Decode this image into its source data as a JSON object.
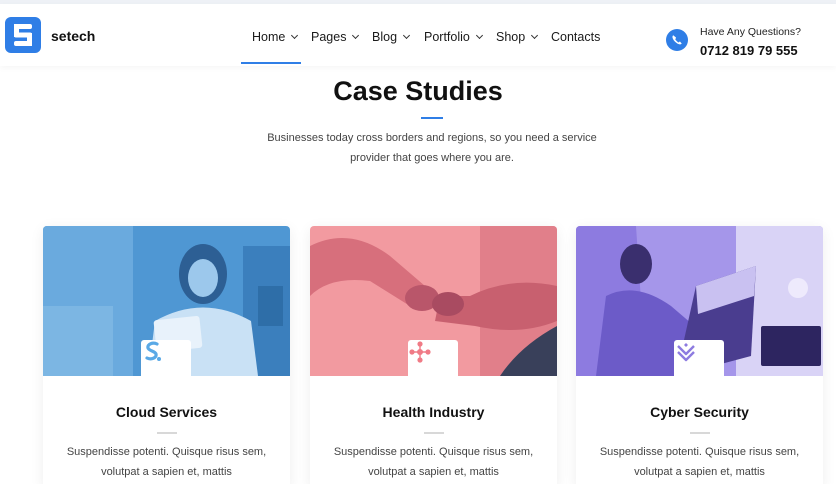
{
  "header": {
    "brand": "setech",
    "nav": [
      {
        "label": "Home",
        "dropdown": true
      },
      {
        "label": "Pages",
        "dropdown": true
      },
      {
        "label": "Blog",
        "dropdown": true
      },
      {
        "label": "Portfolio",
        "dropdown": true
      },
      {
        "label": "Shop",
        "dropdown": true
      },
      {
        "label": "Contacts",
        "dropdown": false
      }
    ],
    "active_nav": "Home",
    "contact": {
      "question": "Have Any Questions?",
      "phone": "0712 819 79 555",
      "icon": "whatsapp-phone-icon"
    }
  },
  "section": {
    "title": "Case Studies",
    "subtitle_line1": "Businesses today cross borders and regions, so you need a service",
    "subtitle_line2": "provider that goes where you are."
  },
  "cards": [
    {
      "title": "Cloud Services",
      "text_line1": "Suspendisse potenti. Quisque risus sem,",
      "text_line2": "volutpat a sapien et, mattis",
      "icon": "cloud-s-icon",
      "tint": "#5aa9e6"
    },
    {
      "title": "Health Industry",
      "text_line1": "Suspendisse potenti. Quisque risus sem,",
      "text_line2": "volutpat a sapien et, mattis",
      "icon": "molecule-icon",
      "tint": "#f07b86"
    },
    {
      "title": "Cyber Security",
      "text_line1": "Suspendisse potenti. Quisque risus sem,",
      "text_line2": "volutpat a sapien et, mattis",
      "icon": "chevron-layers-icon",
      "tint": "#8d7be0"
    }
  ],
  "colors": {
    "accent": "#2f7ee6",
    "text": "#111111"
  }
}
